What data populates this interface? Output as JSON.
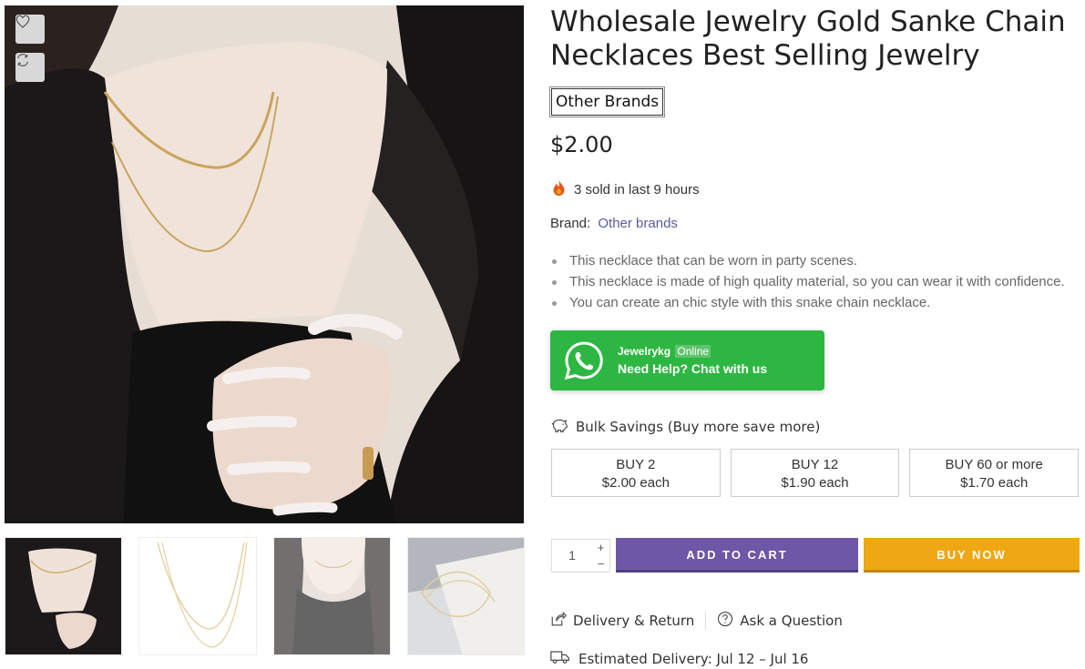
{
  "product": {
    "title": "Wholesale Jewelry Gold Sanke Chain Necklaces Best Selling Jewelry",
    "brand_badge": "Other Brands",
    "price": "$2.00",
    "sold_text": "3 sold in last 9 hours",
    "brand_label": "Brand:",
    "brand_link": "Other brands",
    "bullets": [
      "This necklace that can be worn in party scenes.",
      "This necklace is made of high quality material, so you can wear it with confidence.",
      "You can create an chic style with this snake chain necklace."
    ]
  },
  "gallery": {
    "icons": {
      "wishlist": "heart-icon",
      "compare": "refresh-icon"
    },
    "thumbnail_count": 4
  },
  "whatsapp": {
    "name": "Jewelrykg",
    "status": "Online",
    "cta": "Need Help? Chat with us",
    "color": "#2db742"
  },
  "bulk": {
    "title": "Bulk Savings (Buy more save more)",
    "tiers": [
      {
        "qty": "BUY 2",
        "price": "$2.00 each"
      },
      {
        "qty": "BUY 12",
        "price": "$1.90 each"
      },
      {
        "qty": "BUY 60 or more",
        "price": "$1.70 each"
      }
    ]
  },
  "cart": {
    "quantity": "1",
    "plus": "+",
    "minus": "−",
    "add_to_cart": "ADD TO CART",
    "buy_now": "BUY NOW",
    "add_color": "#6e57a6",
    "buy_color": "#f0a714"
  },
  "links": {
    "delivery_return": "Delivery & Return",
    "ask_question": "Ask a Question",
    "estimated_delivery": "Estimated Delivery: Jul 12 – Jul 16"
  }
}
